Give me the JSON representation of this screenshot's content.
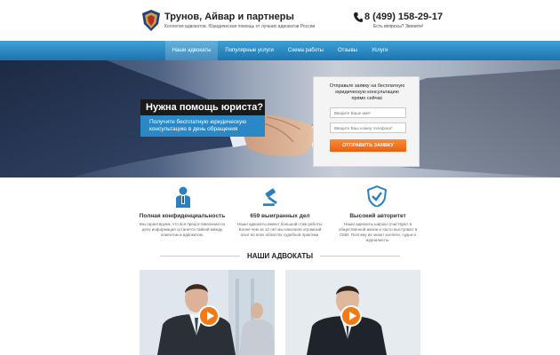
{
  "header": {
    "brand_name": "Трунов, Айвар и партнеры",
    "brand_tagline": "Коллегия адвокатов. Юридическая помощь от лучших адвокатов России",
    "phone": "8 (499) 158-29-17",
    "phone_sub": "Есть вопросы? Звоните!"
  },
  "nav": {
    "items": [
      {
        "label": "Наши адвокаты"
      },
      {
        "label": "Популярные услуги"
      },
      {
        "label": "Схема работы"
      },
      {
        "label": "Отзывы"
      },
      {
        "label": "Услуги"
      }
    ]
  },
  "hero": {
    "headline": "Нужна помощь юриста?",
    "subtitle": "Получите бесплатную юридическую консультацию в день обращения"
  },
  "form": {
    "title_line1": "Отправьте заявку на бесплатную",
    "title_line2": "юридическую консультацию",
    "title_line3": "прямо сейчас",
    "name_placeholder": "Введите Ваше имя*",
    "phone_placeholder": "Введите Ваш номер телефона*",
    "submit_label": "ОТПРАВИТЬ ЗАЯВКУ"
  },
  "features": [
    {
      "title": "Полная конфиденциальность",
      "text": "Мы гарантируем, что вся предоставленная по делу информация останется тайной между клиентом и адвокатом."
    },
    {
      "title": "659 выигранных дел",
      "text": "Наши адвокаты имеют большой стаж работы. Более чем за 12 лет мы накопили огромный опыт во всех областях судебной практики."
    },
    {
      "title": "Высокий авторитет",
      "text": "Наши адвокаты широко участвуют в общественной жизни и часто выступают в СМИ. Поэтому их знают коллеги, судьи и журналисты."
    }
  ],
  "lawyers_section": {
    "title": "НАШИ АДВОКАТЫ"
  },
  "colors": {
    "nav_blue": "#2a88c6",
    "accent_orange": "#f07a18",
    "dark": "#1a1a1a"
  }
}
